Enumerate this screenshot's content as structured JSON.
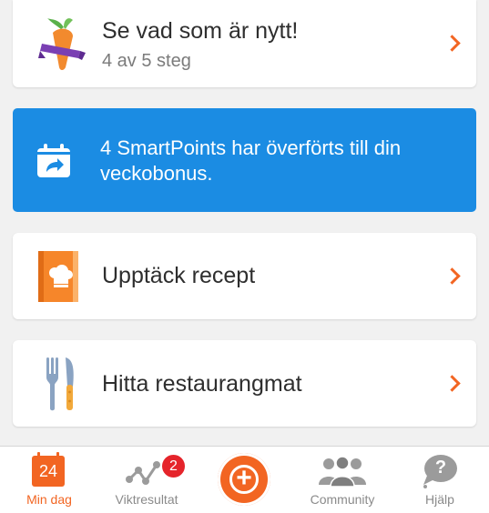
{
  "cards": {
    "whats_new": {
      "title": "Se vad som är nytt!",
      "subtitle": "4 av 5 steg"
    },
    "bonus": {
      "message": "4 SmartPoints har överförts till din veckobonus."
    },
    "recipes": {
      "title": "Upptäck recept"
    },
    "restaurants": {
      "title": "Hitta restaurangmat"
    }
  },
  "bottom_nav": {
    "my_day": {
      "label": "Min dag",
      "date": "24"
    },
    "weight": {
      "label": "Viktresultat",
      "badge": "2"
    },
    "add": {
      "symbol": "+"
    },
    "community": {
      "label": "Community"
    },
    "help": {
      "label": "Hjälp",
      "symbol": "?"
    }
  },
  "colors": {
    "accent": "#f26522",
    "blue_card": "#1b8ce3",
    "badge": "#e5242b",
    "inactive": "#8a8a8a"
  },
  "icons": [
    "carrot-icon",
    "calendar-share-icon",
    "recipe-book-icon",
    "fork-knife-icon",
    "calendar-icon",
    "weight-graph-icon",
    "plus-icon",
    "community-icon",
    "help-bubble-icon",
    "chevron-right-icon"
  ]
}
